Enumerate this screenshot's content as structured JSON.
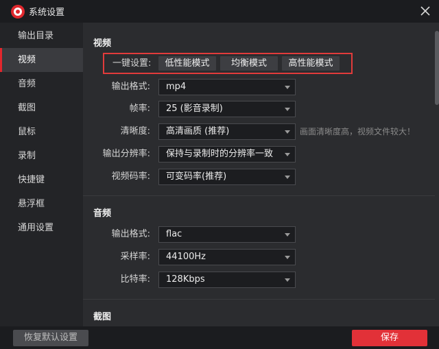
{
  "window": {
    "title": "系统设置"
  },
  "sidebar": {
    "items": [
      {
        "label": "输出目录"
      },
      {
        "label": "视频"
      },
      {
        "label": "音频"
      },
      {
        "label": "截图"
      },
      {
        "label": "鼠标"
      },
      {
        "label": "录制"
      },
      {
        "label": "快捷键"
      },
      {
        "label": "悬浮框"
      },
      {
        "label": "通用设置"
      }
    ],
    "active": "视频"
  },
  "video": {
    "section_title": "视频",
    "preset": {
      "label": "一键设置:",
      "low": "低性能模式",
      "balanced": "均衡模式",
      "high": "高性能模式"
    },
    "format": {
      "label": "输出格式:",
      "value": "mp4"
    },
    "framerate": {
      "label": "帧率:",
      "value": "25 (影音录制)"
    },
    "quality": {
      "label": "清晰度:",
      "value": "高清画质 (推荐)",
      "hint": "画面清晰度高，视频文件较大！"
    },
    "resolution": {
      "label": "输出分辨率:",
      "value": "保持与录制时的分辨率一致"
    },
    "bitrate": {
      "label": "视频码率:",
      "value": "可变码率(推荐)"
    }
  },
  "audio": {
    "section_title": "音频",
    "format": {
      "label": "输出格式:",
      "value": "flac"
    },
    "samplerate": {
      "label": "采样率:",
      "value": "44100Hz"
    },
    "bitrate": {
      "label": "比特率:",
      "value": "128Kbps"
    }
  },
  "screenshot": {
    "section_title": "截图"
  },
  "footer": {
    "restore_label": "恢复默认设置",
    "save_label": "保存"
  },
  "colors": {
    "accent": "#e23138",
    "highlight_box": "#e23b3b",
    "background": "#2b2c2f"
  }
}
